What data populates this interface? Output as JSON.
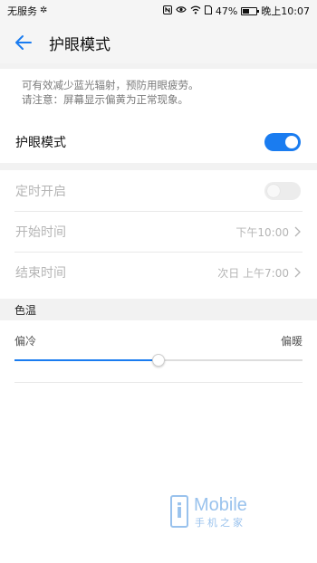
{
  "status_bar": {
    "carrier": "无服务",
    "battery": "47%",
    "time": "晚上10:07",
    "icons": [
      "usb-icon",
      "nfc-icon",
      "eye-icon",
      "wifi-icon",
      "battery-icon"
    ]
  },
  "title_bar": {
    "title": "护眼模式",
    "back_icon": "arrow-left-icon"
  },
  "description": {
    "line1": "可有效减少蓝光辐射，预防用眼疲劳。",
    "line2": "请注意：屏幕显示偏黄为正常现象。"
  },
  "eye_mode": {
    "label": "护眼模式",
    "enabled": true
  },
  "schedule": {
    "label": "定时开启",
    "enabled": false
  },
  "start_time": {
    "label": "开始时间",
    "value": "下午10:00"
  },
  "end_time": {
    "label": "结束时间",
    "value": "次日 上午7:00"
  },
  "color_temp": {
    "header": "色温",
    "left_label": "偏冷",
    "right_label": "偏暖",
    "value": 0.5
  },
  "watermark": {
    "brand": "Mobile",
    "sub": "手机之家"
  },
  "colors": {
    "accent": "#1a7cf0",
    "disabled_text": "#b5b5b5"
  }
}
